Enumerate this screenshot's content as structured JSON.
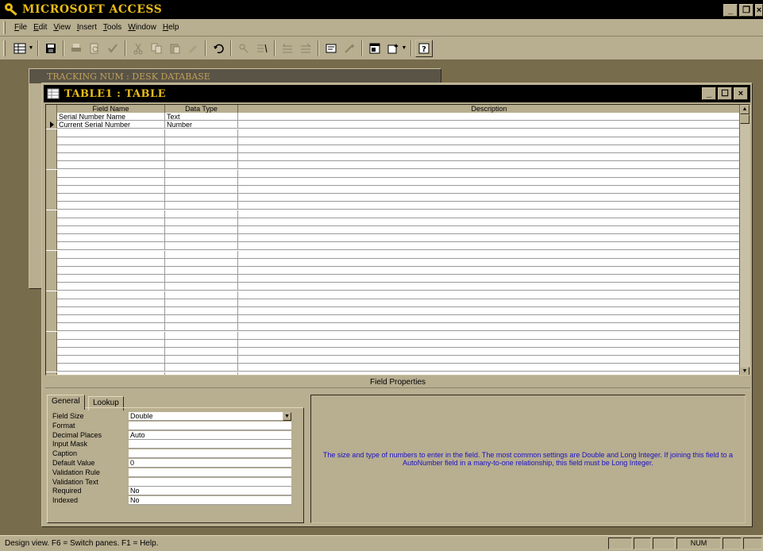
{
  "app": {
    "title": "MICROSOFT ACCESS"
  },
  "menu": [
    {
      "key": "F",
      "rest": "ile"
    },
    {
      "key": "E",
      "rest": "dit"
    },
    {
      "key": "V",
      "rest": "iew"
    },
    {
      "key": "I",
      "rest": "nsert"
    },
    {
      "key": "T",
      "rest": "ools"
    },
    {
      "key": "W",
      "rest": "indow"
    },
    {
      "key": "H",
      "rest": "elp"
    }
  ],
  "db_window": {
    "title": "TRACKING NUM : DESK DATABASE"
  },
  "table_window": {
    "title": "TABLE1 : TABLE"
  },
  "grid": {
    "headers": {
      "field_name": "Field Name",
      "data_type": "Data Type",
      "description": "Description"
    },
    "rows": [
      {
        "field_name": "Serial Number Name",
        "data_type": "Text",
        "description": ""
      },
      {
        "field_name": "Current Serial Number",
        "data_type": "Number",
        "description": ""
      }
    ],
    "current_row_index": 1
  },
  "field_properties": {
    "header": "Field Properties",
    "tabs": [
      "General",
      "Lookup"
    ],
    "properties": [
      {
        "label": "Field Size",
        "value": "Double"
      },
      {
        "label": "Format",
        "value": ""
      },
      {
        "label": "Decimal Places",
        "value": "Auto"
      },
      {
        "label": "Input Mask",
        "value": ""
      },
      {
        "label": "Caption",
        "value": ""
      },
      {
        "label": "Default Value",
        "value": "0"
      },
      {
        "label": "Validation Rule",
        "value": ""
      },
      {
        "label": "Validation Text",
        "value": ""
      },
      {
        "label": "Required",
        "value": "No"
      },
      {
        "label": "Indexed",
        "value": "No"
      }
    ],
    "help_text": "The size and type of numbers to enter in the field.  The most common settings are Double and Long Integer.  If joining this field to a AutoNumber field in a many-to-one relationship, this field must be Long Integer."
  },
  "status": {
    "text": "Design view.  F6 = Switch panes.  F1 = Help.",
    "num": "NUM"
  },
  "colors": {
    "title_bar": "#000000",
    "title_text": "#e8bc18",
    "chrome": "#b8ae90",
    "desktop": "#776c4c",
    "help_text": "#1a10c8"
  }
}
